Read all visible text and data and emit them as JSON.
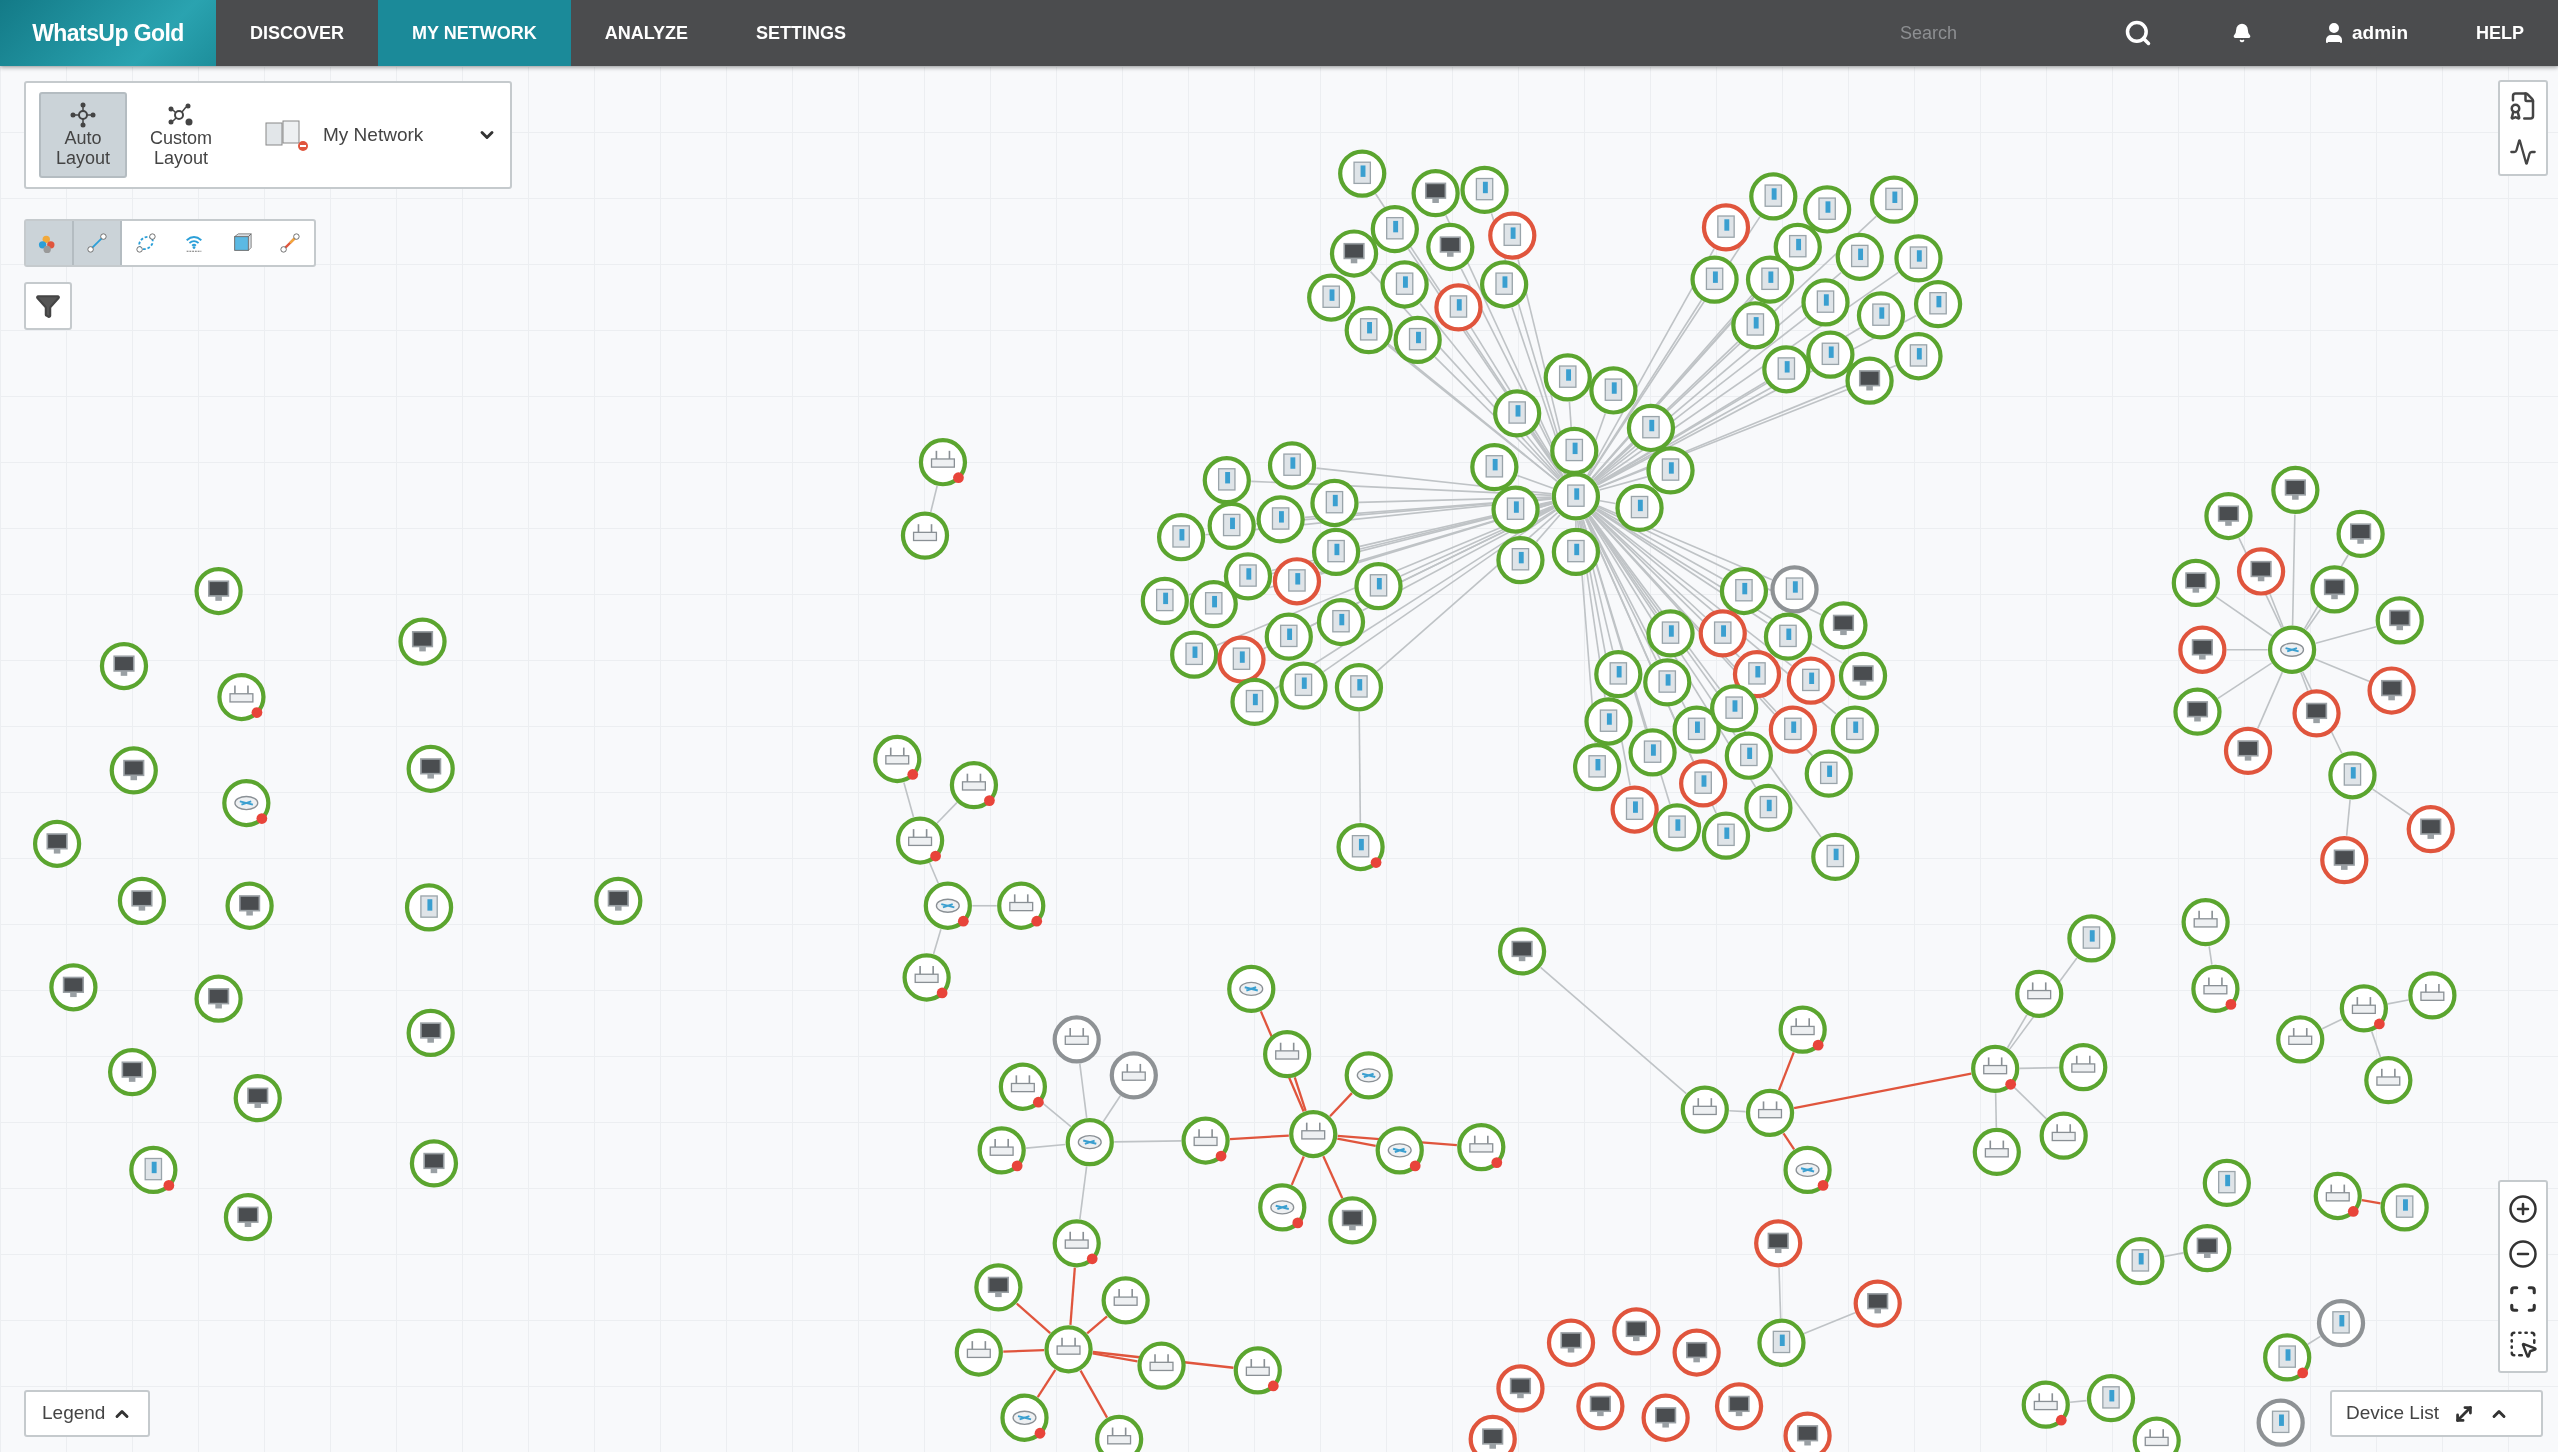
{
  "app": {
    "logo": "WhatsUp Gold"
  },
  "nav": {
    "tabs": [
      {
        "label": "DISCOVER",
        "selected": false
      },
      {
        "label": "MY NETWORK",
        "selected": true
      },
      {
        "label": "ANALYZE",
        "selected": false
      },
      {
        "label": "SETTINGS",
        "selected": false
      }
    ]
  },
  "search": {
    "placeholder": "Search"
  },
  "user": {
    "name": "admin"
  },
  "help": "HELP",
  "layout_panel": {
    "buttons": [
      {
        "kind": "auto",
        "label": "Auto Layout",
        "selected": true
      },
      {
        "kind": "custom",
        "label": "Custom Layout",
        "selected": false
      }
    ],
    "group": "My Network"
  },
  "view_toolbar": {
    "buttons": [
      {
        "kind": "status",
        "selected": true
      },
      {
        "kind": "links",
        "selected": true
      },
      {
        "kind": "logical",
        "selected": false
      },
      {
        "kind": "wireless",
        "selected": false
      },
      {
        "kind": "virtual",
        "selected": false
      },
      {
        "kind": "connection",
        "selected": false
      }
    ]
  },
  "legend": {
    "label": "Legend"
  },
  "device_list": {
    "label": "Device List"
  }
}
